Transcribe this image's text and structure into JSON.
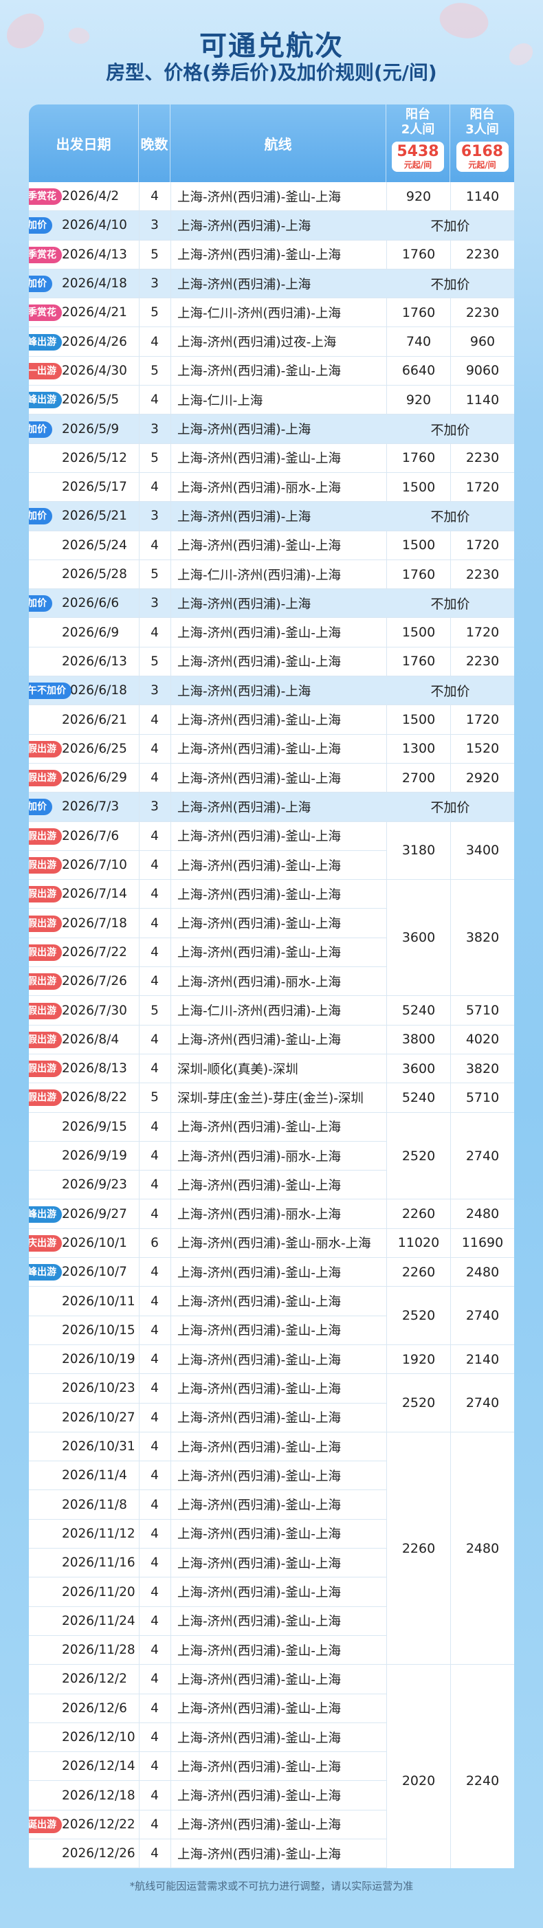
{
  "header": {
    "title": "可通兑航次",
    "subtitle": "房型、价格(券后价)及加价规则(元/间)"
  },
  "table": {
    "columns": {
      "date": "出发日期",
      "nights": "晚数",
      "route": "航线",
      "balcony2_line1": "阳台",
      "balcony2_line2": "2人间",
      "balcony2_price": "5438",
      "balcony2_unit": "元起/间",
      "balcony3_line1": "阳台",
      "balcony3_line2": "3人间",
      "balcony3_price": "6168",
      "balcony3_unit": "元起/间"
    },
    "no_surcharge_text": "不加价",
    "rows": [
      {
        "badge": "春季赏花",
        "badge_color": "#e94f8a",
        "date": "2026/4/2",
        "nights": "4",
        "route": "上海-济州(西归浦)-釜山-上海",
        "hl": false
      },
      {
        "badge": "不加价",
        "badge_color": "#2f86e6",
        "date": "2026/4/10",
        "nights": "3",
        "route": "上海-济州(西归浦)-上海",
        "hl": true
      },
      {
        "badge": "春季赏花",
        "badge_color": "#e94f8a",
        "date": "2026/4/13",
        "nights": "5",
        "route": "上海-济州(西归浦)-釜山-上海",
        "hl": false
      },
      {
        "badge": "不加价",
        "badge_color": "#2f86e6",
        "date": "2026/4/18",
        "nights": "3",
        "route": "上海-济州(西归浦)-上海",
        "hl": true
      },
      {
        "badge": "春季赏花",
        "badge_color": "#e94f8a",
        "date": "2026/4/21",
        "nights": "5",
        "route": "上海-仁川-济州(西归浦)-上海",
        "hl": false
      },
      {
        "badge": "错峰出游",
        "badge_color": "#2a8ed8",
        "date": "2026/4/26",
        "nights": "4",
        "route": "上海-济州(西归浦)过夜-上海",
        "hl": false
      },
      {
        "badge": "五一出游",
        "badge_color": "#ec5a5a",
        "date": "2026/4/30",
        "nights": "5",
        "route": "上海-济州(西归浦)-釜山-上海",
        "hl": false
      },
      {
        "badge": "错峰出游",
        "badge_color": "#2a8ed8",
        "date": "2026/5/5",
        "nights": "4",
        "route": "上海-仁川-上海",
        "hl": false
      },
      {
        "badge": "不加价",
        "badge_color": "#2f86e6",
        "date": "2026/5/9",
        "nights": "3",
        "route": "上海-济州(西归浦)-上海",
        "hl": true
      },
      {
        "badge": "",
        "badge_color": "",
        "date": "2026/5/12",
        "nights": "5",
        "route": "上海-济州(西归浦)-釜山-上海",
        "hl": false
      },
      {
        "badge": "",
        "badge_color": "",
        "date": "2026/5/17",
        "nights": "4",
        "route": "上海-济州(西归浦)-丽水-上海",
        "hl": false
      },
      {
        "badge": "不加价",
        "badge_color": "#2f86e6",
        "date": "2026/5/21",
        "nights": "3",
        "route": "上海-济州(西归浦)-上海",
        "hl": true
      },
      {
        "badge": "",
        "badge_color": "",
        "date": "2026/5/24",
        "nights": "4",
        "route": "上海-济州(西归浦)-釜山-上海",
        "hl": false
      },
      {
        "badge": "",
        "badge_color": "",
        "date": "2026/5/28",
        "nights": "5",
        "route": "上海-仁川-济州(西归浦)-上海",
        "hl": false
      },
      {
        "badge": "不加价",
        "badge_color": "#2f86e6",
        "date": "2026/6/6",
        "nights": "3",
        "route": "上海-济州(西归浦)-上海",
        "hl": true
      },
      {
        "badge": "",
        "badge_color": "",
        "date": "2026/6/9",
        "nights": "4",
        "route": "上海-济州(西归浦)-釜山-上海",
        "hl": false
      },
      {
        "badge": "",
        "badge_color": "",
        "date": "2026/6/13",
        "nights": "5",
        "route": "上海-济州(西归浦)-釜山-上海",
        "hl": false
      },
      {
        "badge": "端午不加价",
        "badge_color": "#2f86e6",
        "date": "2026/6/18",
        "nights": "3",
        "route": "上海-济州(西归浦)-上海",
        "hl": true
      },
      {
        "badge": "",
        "badge_color": "",
        "date": "2026/6/21",
        "nights": "4",
        "route": "上海-济州(西归浦)-釜山-上海",
        "hl": false
      },
      {
        "badge": "暑假出游",
        "badge_color": "#ec5a5a",
        "date": "2026/6/25",
        "nights": "4",
        "route": "上海-济州(西归浦)-釜山-上海",
        "hl": false
      },
      {
        "badge": "暑假出游",
        "badge_color": "#ec5a5a",
        "date": "2026/6/29",
        "nights": "4",
        "route": "上海-济州(西归浦)-釜山-上海",
        "hl": false
      },
      {
        "badge": "不加价",
        "badge_color": "#2f86e6",
        "date": "2026/7/3",
        "nights": "3",
        "route": "上海-济州(西归浦)-上海",
        "hl": true
      },
      {
        "badge": "暑假出游",
        "badge_color": "#ec5a5a",
        "date": "2026/7/6",
        "nights": "4",
        "route": "上海-济州(西归浦)-釜山-上海",
        "hl": false
      },
      {
        "badge": "暑假出游",
        "badge_color": "#ec5a5a",
        "date": "2026/7/10",
        "nights": "4",
        "route": "上海-济州(西归浦)-釜山-上海",
        "hl": false
      },
      {
        "badge": "暑假出游",
        "badge_color": "#ec5a5a",
        "date": "2026/7/14",
        "nights": "4",
        "route": "上海-济州(西归浦)-釜山-上海",
        "hl": false
      },
      {
        "badge": "暑假出游",
        "badge_color": "#ec5a5a",
        "date": "2026/7/18",
        "nights": "4",
        "route": "上海-济州(西归浦)-釜山-上海",
        "hl": false
      },
      {
        "badge": "暑假出游",
        "badge_color": "#ec5a5a",
        "date": "2026/7/22",
        "nights": "4",
        "route": "上海-济州(西归浦)-釜山-上海",
        "hl": false
      },
      {
        "badge": "暑假出游",
        "badge_color": "#ec5a5a",
        "date": "2026/7/26",
        "nights": "4",
        "route": "上海-济州(西归浦)-丽水-上海",
        "hl": false
      },
      {
        "badge": "暑假出游",
        "badge_color": "#ec5a5a",
        "date": "2026/7/30",
        "nights": "5",
        "route": "上海-仁川-济州(西归浦)-上海",
        "hl": false
      },
      {
        "badge": "暑假出游",
        "badge_color": "#ec5a5a",
        "date": "2026/8/4",
        "nights": "4",
        "route": "上海-济州(西归浦)-釜山-上海",
        "hl": false
      },
      {
        "badge": "暑假出游",
        "badge_color": "#ec5a5a",
        "date": "2026/8/13",
        "nights": "4",
        "route": "深圳-顺化(真美)-深圳",
        "hl": false
      },
      {
        "badge": "暑假出游",
        "badge_color": "#ec5a5a",
        "date": "2026/8/22",
        "nights": "5",
        "route": "深圳-芽庄(金兰)-芽庄(金兰)-深圳",
        "hl": false
      },
      {
        "badge": "",
        "badge_color": "",
        "date": "2026/9/15",
        "nights": "4",
        "route": "上海-济州(西归浦)-釜山-上海",
        "hl": false
      },
      {
        "badge": "",
        "badge_color": "",
        "date": "2026/9/19",
        "nights": "4",
        "route": "上海-济州(西归浦)-丽水-上海",
        "hl": false
      },
      {
        "badge": "",
        "badge_color": "",
        "date": "2026/9/23",
        "nights": "4",
        "route": "上海-济州(西归浦)-釜山-上海",
        "hl": false
      },
      {
        "badge": "错峰出游",
        "badge_color": "#2a8ed8",
        "date": "2026/9/27",
        "nights": "4",
        "route": "上海-济州(西归浦)-丽水-上海",
        "hl": false
      },
      {
        "badge": "国庆出游",
        "badge_color": "#ec5a5a",
        "date": "2026/10/1",
        "nights": "6",
        "route": "上海-济州(西归浦)-釜山-丽水-上海",
        "hl": false
      },
      {
        "badge": "错峰出游",
        "badge_color": "#2a8ed8",
        "date": "2026/10/7",
        "nights": "4",
        "route": "上海-济州(西归浦)-釜山-上海",
        "hl": false
      },
      {
        "badge": "",
        "badge_color": "",
        "date": "2026/10/11",
        "nights": "4",
        "route": "上海-济州(西归浦)-釜山-上海",
        "hl": false
      },
      {
        "badge": "",
        "badge_color": "",
        "date": "2026/10/15",
        "nights": "4",
        "route": "上海-济州(西归浦)-釜山-上海",
        "hl": false
      },
      {
        "badge": "",
        "badge_color": "",
        "date": "2026/10/19",
        "nights": "4",
        "route": "上海-济州(西归浦)-釜山-上海",
        "hl": false
      },
      {
        "badge": "",
        "badge_color": "",
        "date": "2026/10/23",
        "nights": "4",
        "route": "上海-济州(西归浦)-釜山-上海",
        "hl": false
      },
      {
        "badge": "",
        "badge_color": "",
        "date": "2026/10/27",
        "nights": "4",
        "route": "上海-济州(西归浦)-釜山-上海",
        "hl": false
      },
      {
        "badge": "",
        "badge_color": "",
        "date": "2026/10/31",
        "nights": "4",
        "route": "上海-济州(西归浦)-釜山-上海",
        "hl": false
      },
      {
        "badge": "",
        "badge_color": "",
        "date": "2026/11/4",
        "nights": "4",
        "route": "上海-济州(西归浦)-釜山-上海",
        "hl": false
      },
      {
        "badge": "",
        "badge_color": "",
        "date": "2026/11/8",
        "nights": "4",
        "route": "上海-济州(西归浦)-釜山-上海",
        "hl": false
      },
      {
        "badge": "",
        "badge_color": "",
        "date": "2026/11/12",
        "nights": "4",
        "route": "上海-济州(西归浦)-釜山-上海",
        "hl": false
      },
      {
        "badge": "",
        "badge_color": "",
        "date": "2026/11/16",
        "nights": "4",
        "route": "上海-济州(西归浦)-釜山-上海",
        "hl": false
      },
      {
        "badge": "",
        "badge_color": "",
        "date": "2026/11/20",
        "nights": "4",
        "route": "上海-济州(西归浦)-釜山-上海",
        "hl": false
      },
      {
        "badge": "",
        "badge_color": "",
        "date": "2026/11/24",
        "nights": "4",
        "route": "上海-济州(西归浦)-釜山-上海",
        "hl": false
      },
      {
        "badge": "",
        "badge_color": "",
        "date": "2026/11/28",
        "nights": "4",
        "route": "上海-济州(西归浦)-釜山-上海",
        "hl": false
      },
      {
        "badge": "",
        "badge_color": "",
        "date": "2026/12/2",
        "nights": "4",
        "route": "上海-济州(西归浦)-釜山-上海",
        "hl": false
      },
      {
        "badge": "",
        "badge_color": "",
        "date": "2026/12/6",
        "nights": "4",
        "route": "上海-济州(西归浦)-釜山-上海",
        "hl": false
      },
      {
        "badge": "",
        "badge_color": "",
        "date": "2026/12/10",
        "nights": "4",
        "route": "上海-济州(西归浦)-釜山-上海",
        "hl": false
      },
      {
        "badge": "",
        "badge_color": "",
        "date": "2026/12/14",
        "nights": "4",
        "route": "上海-济州(西归浦)-釜山-上海",
        "hl": false
      },
      {
        "badge": "",
        "badge_color": "",
        "date": "2026/12/18",
        "nights": "4",
        "route": "上海-济州(西归浦)-釜山-上海",
        "hl": false
      },
      {
        "badge": "圣诞出游",
        "badge_color": "#ec5a5a",
        "date": "2026/12/22",
        "nights": "4",
        "route": "上海-济州(西归浦)-釜山-上海",
        "hl": false
      },
      {
        "badge": "",
        "badge_color": "",
        "date": "2026/12/26",
        "nights": "4",
        "route": "上海-济州(西归浦)-釜山-上海",
        "hl": false
      }
    ],
    "price_groups": [
      {
        "start": 0,
        "span": 1,
        "p2": "920",
        "p3": "1140"
      },
      {
        "start": 1,
        "span": 1,
        "nojia": true
      },
      {
        "start": 2,
        "span": 1,
        "p2": "1760",
        "p3": "2230"
      },
      {
        "start": 3,
        "span": 1,
        "nojia": true
      },
      {
        "start": 4,
        "span": 1,
        "p2": "1760",
        "p3": "2230"
      },
      {
        "start": 5,
        "span": 1,
        "p2": "740",
        "p3": "960"
      },
      {
        "start": 6,
        "span": 1,
        "p2": "6640",
        "p3": "9060"
      },
      {
        "start": 7,
        "span": 1,
        "p2": "920",
        "p3": "1140"
      },
      {
        "start": 8,
        "span": 1,
        "nojia": true
      },
      {
        "start": 9,
        "span": 1,
        "p2": "1760",
        "p3": "2230"
      },
      {
        "start": 10,
        "span": 1,
        "p2": "1500",
        "p3": "1720"
      },
      {
        "start": 11,
        "span": 1,
        "nojia": true
      },
      {
        "start": 12,
        "span": 1,
        "p2": "1500",
        "p3": "1720"
      },
      {
        "start": 13,
        "span": 1,
        "p2": "1760",
        "p3": "2230"
      },
      {
        "start": 14,
        "span": 1,
        "nojia": true
      },
      {
        "start": 15,
        "span": 1,
        "p2": "1500",
        "p3": "1720"
      },
      {
        "start": 16,
        "span": 1,
        "p2": "1760",
        "p3": "2230"
      },
      {
        "start": 17,
        "span": 1,
        "nojia": true
      },
      {
        "start": 18,
        "span": 1,
        "p2": "1500",
        "p3": "1720"
      },
      {
        "start": 19,
        "span": 1,
        "p2": "1300",
        "p3": "1520"
      },
      {
        "start": 20,
        "span": 1,
        "p2": "2700",
        "p3": "2920"
      },
      {
        "start": 21,
        "span": 1,
        "nojia": true
      },
      {
        "start": 22,
        "span": 2,
        "p2": "3180",
        "p3": "3400"
      },
      {
        "start": 24,
        "span": 4,
        "p2": "3600",
        "p3": "3820"
      },
      {
        "start": 28,
        "span": 1,
        "p2": "5240",
        "p3": "5710"
      },
      {
        "start": 29,
        "span": 1,
        "p2": "3800",
        "p3": "4020"
      },
      {
        "start": 30,
        "span": 1,
        "p2": "3600",
        "p3": "3820"
      },
      {
        "start": 31,
        "span": 1,
        "p2": "5240",
        "p3": "5710"
      },
      {
        "start": 32,
        "span": 3,
        "p2": "2520",
        "p3": "2740"
      },
      {
        "start": 35,
        "span": 1,
        "p2": "2260",
        "p3": "2480"
      },
      {
        "start": 36,
        "span": 1,
        "p2": "11020",
        "p3": "11690"
      },
      {
        "start": 37,
        "span": 1,
        "p2": "2260",
        "p3": "2480"
      },
      {
        "start": 38,
        "span": 2,
        "p2": "2520",
        "p3": "2740"
      },
      {
        "start": 40,
        "span": 1,
        "p2": "1920",
        "p3": "2140"
      },
      {
        "start": 41,
        "span": 2,
        "p2": "2520",
        "p3": "2740"
      },
      {
        "start": 43,
        "span": 8,
        "p2": "2260",
        "p3": "2480"
      },
      {
        "start": 51,
        "span": 8,
        "p2": "2020",
        "p3": "2240"
      }
    ]
  },
  "footer": "*航线可能因运营需求或不可抗力进行调整，请以实际运营为准"
}
